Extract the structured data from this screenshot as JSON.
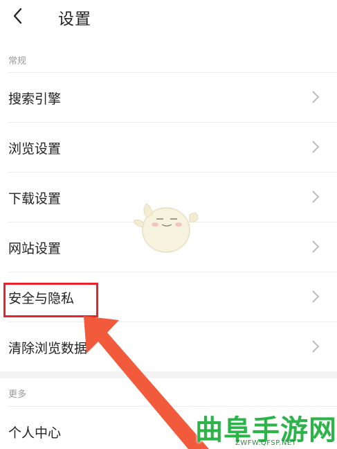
{
  "header": {
    "title": "设置"
  },
  "sections": {
    "general": {
      "label": "常规"
    },
    "more": {
      "label": "更多"
    }
  },
  "items": [
    {
      "label": "搜索引擎"
    },
    {
      "label": "浏览设置"
    },
    {
      "label": "下载设置"
    },
    {
      "label": "网站设置"
    },
    {
      "label": "安全与隐私"
    },
    {
      "label": "清除浏览数据"
    },
    {
      "label": "个人中心"
    }
  ],
  "watermark": {
    "title": "曲阜手游网",
    "url": "ZWFW.QFSP.NET"
  },
  "colors": {
    "highlight": "#e8232a",
    "arrow": "#f25a3c",
    "watermark": "#2db34a"
  }
}
